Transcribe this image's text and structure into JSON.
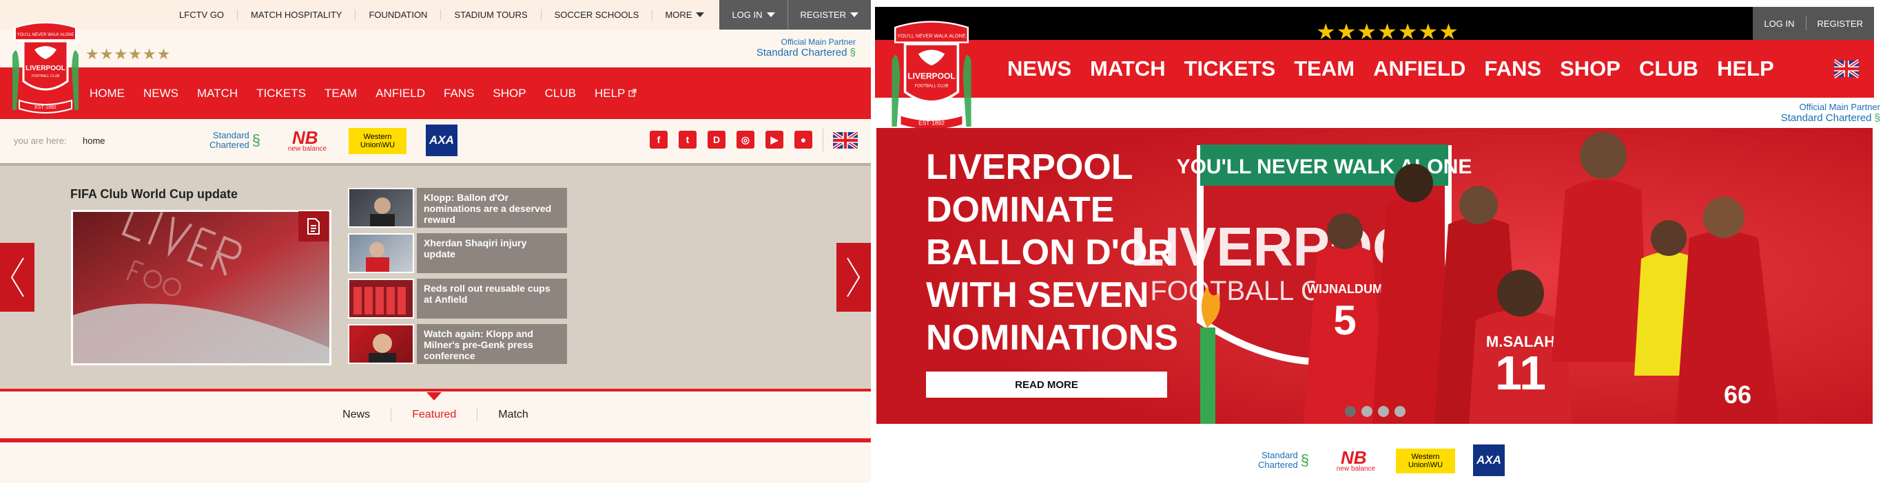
{
  "left": {
    "top_nav": [
      "LFCTV GO",
      "MATCH HOSPITALITY",
      "FOUNDATION",
      "STADIUM TOURS",
      "SOCCER SCHOOLS"
    ],
    "more": "MORE",
    "login": "LOG IN",
    "register": "REGISTER",
    "stars": "★★★★★★",
    "partner_label": "Official Main Partner",
    "partner_name": "Standard Chartered",
    "crest_motto": "YOU'LL NEVER WALK ALONE",
    "crest_club": "LIVERPOOL",
    "crest_fc": "FOOTBALL CLUB",
    "crest_est": "EST·1892",
    "main_nav": [
      "HOME",
      "NEWS",
      "MATCH",
      "TICKETS",
      "TEAM",
      "ANFIELD",
      "FANS",
      "SHOP",
      "CLUB",
      "HELP"
    ],
    "breadcrumb_label": "you are here:",
    "breadcrumb_value": "home",
    "sponsors": {
      "sc": [
        "Standard",
        "Chartered"
      ],
      "nb": "new balance",
      "wu": [
        "Western",
        "Union\\WU"
      ],
      "axa": "AXA"
    },
    "social": [
      "f",
      "t",
      "D",
      "◎",
      "▶",
      "●"
    ],
    "feature_title": "FIFA Club World Cup update",
    "news_items": [
      "Klopp: Ballon d'Or nominations are a deserved reward",
      "Xherdan Shaqiri injury update",
      "Reds roll out reusable cups at Anfield",
      "Watch again: Klopp and Milner's pre-Genk press conference"
    ],
    "tabs": [
      "News",
      "Featured",
      "Match"
    ],
    "active_tab": "Featured"
  },
  "right": {
    "stars": "★★★★★★★",
    "login": "LOG IN",
    "register": "REGISTER",
    "main_nav": [
      "NEWS",
      "MATCH",
      "TICKETS",
      "TEAM",
      "ANFIELD",
      "FANS",
      "SHOP",
      "CLUB",
      "HELP"
    ],
    "partner_label": "Official Main Partner",
    "partner_name": "Standard Chartered",
    "hero_headline": [
      "LIVERPOOL",
      "DOMINATE",
      "BALLON D'OR",
      "WITH SEVEN",
      "NOMINATIONS"
    ],
    "hero_banner": "YOU'LL NEVER WALK ALONE",
    "hero_club": "LIVERPOOL",
    "hero_fc": "FOOTBALL CLUB",
    "players": [
      "WIJNALDUM",
      "5",
      "M.SALAH",
      "11",
      "66"
    ],
    "read_more": "READ MORE",
    "slides": 4,
    "active_slide": 1
  },
  "colors": {
    "lfc_red": "#e31b23",
    "dark_red": "#a3151b",
    "gold": "#b49b5e",
    "star_yellow": "#f5c400",
    "sc_blue": "#1a6fb5",
    "sc_green": "#36a852",
    "wu_yellow": "#ffdd00",
    "axa_blue": "#103184",
    "stage_beige": "#d7cfc4",
    "news_grey": "#8d857e"
  },
  "icons": [
    "crest-icon",
    "chevron-down-icon",
    "external-link-icon",
    "document-icon",
    "chevron-left-icon",
    "chevron-right-icon",
    "facebook-icon",
    "twitter-icon",
    "dugout-icon",
    "instagram-icon",
    "youtube-icon",
    "lfc-app-icon",
    "uk-flag-icon"
  ]
}
